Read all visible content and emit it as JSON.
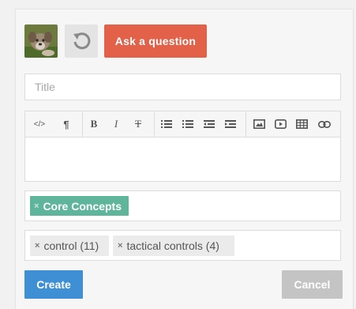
{
  "header": {
    "ask_button_label": "Ask a question"
  },
  "form": {
    "title_placeholder": "Title",
    "title_value": "",
    "toolbar": [
      {
        "name": "code-icon",
        "glyph": "</>"
      },
      {
        "name": "paragraph-icon",
        "glyph": "¶"
      },
      {
        "name": "bold-icon",
        "glyph": "B"
      },
      {
        "name": "italic-icon",
        "glyph": "I"
      },
      {
        "name": "strikethrough-icon",
        "glyph": "T"
      },
      {
        "name": "bulleted-list-icon",
        "glyph": ""
      },
      {
        "name": "numbered-list-icon",
        "glyph": ""
      },
      {
        "name": "outdent-icon",
        "glyph": ""
      },
      {
        "name": "indent-icon",
        "glyph": ""
      },
      {
        "name": "image-icon",
        "glyph": ""
      },
      {
        "name": "video-icon",
        "glyph": ""
      },
      {
        "name": "table-icon",
        "glyph": ""
      },
      {
        "name": "link-icon",
        "glyph": ""
      }
    ],
    "category_tag": {
      "remove": "×",
      "label": "Core Concepts"
    },
    "tags": [
      {
        "remove": "×",
        "label": "control (11)"
      },
      {
        "remove": "×",
        "label": "tactical controls (4)"
      }
    ]
  },
  "footer": {
    "create_label": "Create",
    "cancel_label": "Cancel"
  },
  "colors": {
    "ask_button": "#e36049",
    "category_tag": "#5fb59a",
    "create_button": "#3f8fd4",
    "cancel_button": "#c4c4c4"
  }
}
